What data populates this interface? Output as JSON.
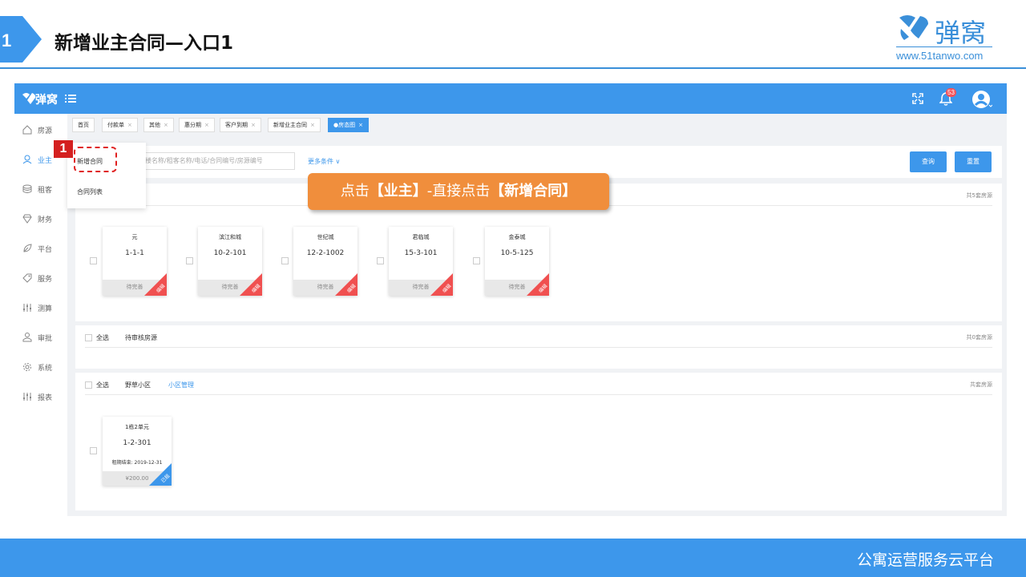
{
  "slide": {
    "number": "1",
    "title": "新增业主合同—入口1",
    "brand_name": "弹窝",
    "brand_url": "www.51tanwo.com",
    "footer": "公寓运营服务云平台",
    "accent_color": "#3d97eb",
    "callout_color": "#f08e3c"
  },
  "app": {
    "name": "弹窝",
    "notification_count": "53"
  },
  "sidebar": {
    "items": [
      {
        "label": "房源",
        "icon": "home-icon"
      },
      {
        "label": "业主",
        "icon": "user-icon"
      },
      {
        "label": "租客",
        "icon": "database-icon"
      },
      {
        "label": "财务",
        "icon": "diamond-icon"
      },
      {
        "label": "平台",
        "icon": "leaf-icon"
      },
      {
        "label": "服务",
        "icon": "tag-icon"
      },
      {
        "label": "测算",
        "icon": "sliders-icon"
      },
      {
        "label": "审批",
        "icon": "person-icon"
      },
      {
        "label": "系统",
        "icon": "gear-icon"
      },
      {
        "label": "报表",
        "icon": "sliders-icon"
      }
    ]
  },
  "tabs": [
    {
      "label": "首页"
    },
    {
      "label": "付款单",
      "close": "×"
    },
    {
      "label": "其他",
      "close": "×"
    },
    {
      "label": "惠分期",
      "close": "×"
    },
    {
      "label": "客户到期",
      "close": "×"
    },
    {
      "label": "新增业主合同",
      "close": "×"
    },
    {
      "label": "●房态图",
      "close": "×"
    }
  ],
  "search": {
    "placeholder": "楼名称/租客名称/电话/合同编号/房源编号",
    "more_filter": "更多条件 ∨",
    "query_button": "查询",
    "reset_button": "重置"
  },
  "submenu": {
    "items": [
      "新增合同",
      "合同列表"
    ]
  },
  "step_badge": "1",
  "callout": {
    "part1": "点击",
    "part2": "【业主】",
    "part3": "-直接点击",
    "part4": "【新增合同】"
  },
  "groups": [
    {
      "title_fragment": "房源",
      "count": "共5套房源",
      "cards": [
        {
          "name": "元",
          "room": "1-1-1",
          "status": "待完善",
          "tag": "编辑"
        },
        {
          "name": "滨江和城",
          "room": "10-2-101",
          "status": "待完善",
          "tag": "编辑"
        },
        {
          "name": "世纪城",
          "room": "12-2-1002",
          "status": "待完善",
          "tag": "编辑"
        },
        {
          "name": "君临城",
          "room": "15-3-101",
          "status": "待完善",
          "tag": "编辑"
        },
        {
          "name": "金泰城",
          "room": "10-5-125",
          "status": "待完善",
          "tag": "编辑"
        }
      ]
    },
    {
      "select_all": "全选",
      "title": "待审核房源",
      "count": "共0套房源"
    },
    {
      "select_all": "全选",
      "title": "野草小区",
      "link": "小区管理",
      "count": "共套房源",
      "cards": [
        {
          "name": "1栋2单元",
          "room": "1-2-301",
          "lease": "租期结束: 2019-12-31",
          "price": "¥200.00",
          "tag": "已租"
        }
      ]
    }
  ]
}
